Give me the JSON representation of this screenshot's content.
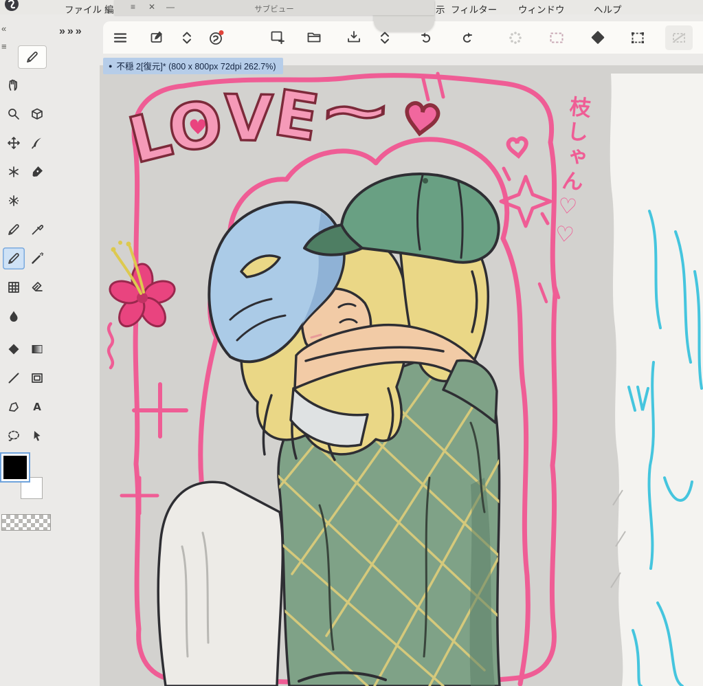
{
  "menu_bar": {
    "items": [
      {
        "label": "ファイル"
      },
      {
        "label": "編"
      },
      {
        "label": "示"
      },
      {
        "label": "フィルター"
      },
      {
        "label": "ウィンドウ"
      },
      {
        "label": "ヘルプ"
      }
    ]
  },
  "floating_panel": {
    "title": "サブビュー",
    "menu_glyph": "≡",
    "close_glyph": "✕",
    "minimize_glyph": "—"
  },
  "panel_controls": {
    "expand_chevrons": "»»»",
    "collapse_glyph": "«",
    "strip_menu_glyph": "≡"
  },
  "toolbar": {
    "buttons": [
      "main-menu",
      "pen-settings-window",
      "panel-toggle",
      "clip-studio-app",
      "new-canvas",
      "open-file",
      "save-export",
      "view-toggle",
      "undo",
      "redo",
      "processing-indicator",
      "marquee-select",
      "shape-select",
      "transform-frame",
      "selection-extra"
    ],
    "notification_color": "#e0443a"
  },
  "document_tab": {
    "unsaved_dot": "●",
    "label": "不穏 2[復元]* (800 x 800px 72dpi 262.7%)"
  },
  "tool_panel": {
    "tools": [
      "hand",
      "zoom",
      "object",
      "move",
      "quill",
      "star-brush",
      "pen",
      "decoration-brush",
      "pencil",
      "eyedropper",
      "pencil-2",
      "airbrush",
      "fill-grid",
      "eraser",
      "blend",
      "figure",
      "gradient",
      "line",
      "frame",
      "polyline",
      "text",
      "lasso",
      "operation"
    ],
    "selected_tool": "pencil-2",
    "primary_color": "#000000",
    "secondary_color": "#ffffff"
  },
  "canvas": {
    "artwork": {
      "love_letters": [
        "L",
        "O",
        "V",
        "E"
      ],
      "tilde": "~",
      "vertical_caption": "枝しゃん♡♡",
      "palette": {
        "outline_pink": "#ef5d95",
        "letter_fill": "#f59ab8",
        "letter_outline": "#7c2a3a",
        "heart_fill": "#f1679e",
        "flower": "#e9447f",
        "flower_center": "#c23364",
        "stamen_yellow": "#ddc94f",
        "beanie_blue": "#abcbe7",
        "cap_green": "#69a083",
        "hair_blonde": "#ead786",
        "skin": "#f2cba6",
        "shirt_green": "#7fa287",
        "plaid_yellow": "#d5c97b",
        "white_shirt": "#edebe7",
        "line_dark": "#2e2e33",
        "sketch_cyan": "#45c5de",
        "canvas_gray": "#d3d2cf",
        "paper_white": "#f4f3f0"
      }
    }
  }
}
